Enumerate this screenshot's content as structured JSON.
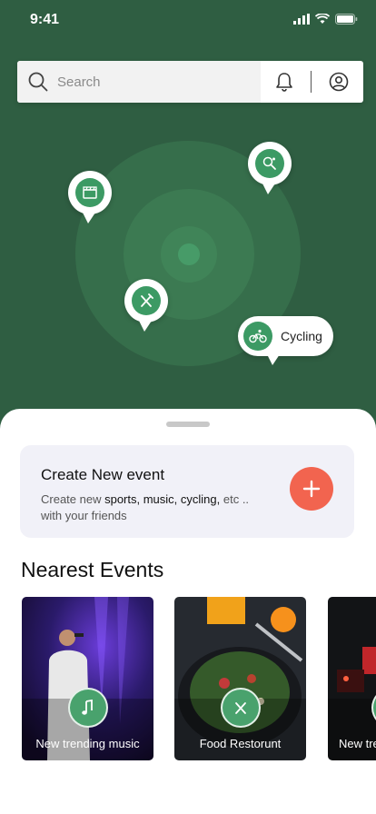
{
  "status": {
    "time": "9:41"
  },
  "search": {
    "placeholder": "Search"
  },
  "map": {
    "cycling_label": "Cycling"
  },
  "create_card": {
    "title": "Create New event",
    "desc_prefix": "Create new ",
    "desc_bold": "sports, music, cycling,",
    "desc_suffix": " etc .. with your friends"
  },
  "nearest": {
    "title": "Nearest Events",
    "events": [
      {
        "label": "New trending music",
        "icon": "music-note-icon"
      },
      {
        "label": "Food Restorunt",
        "icon": "fork-knife-icon"
      },
      {
        "label": "New tre",
        "icon": "event-icon"
      }
    ]
  },
  "colors": {
    "background_green": "#2f5e42",
    "accent_green": "#3c9a64",
    "add_button": "#f2644f"
  }
}
